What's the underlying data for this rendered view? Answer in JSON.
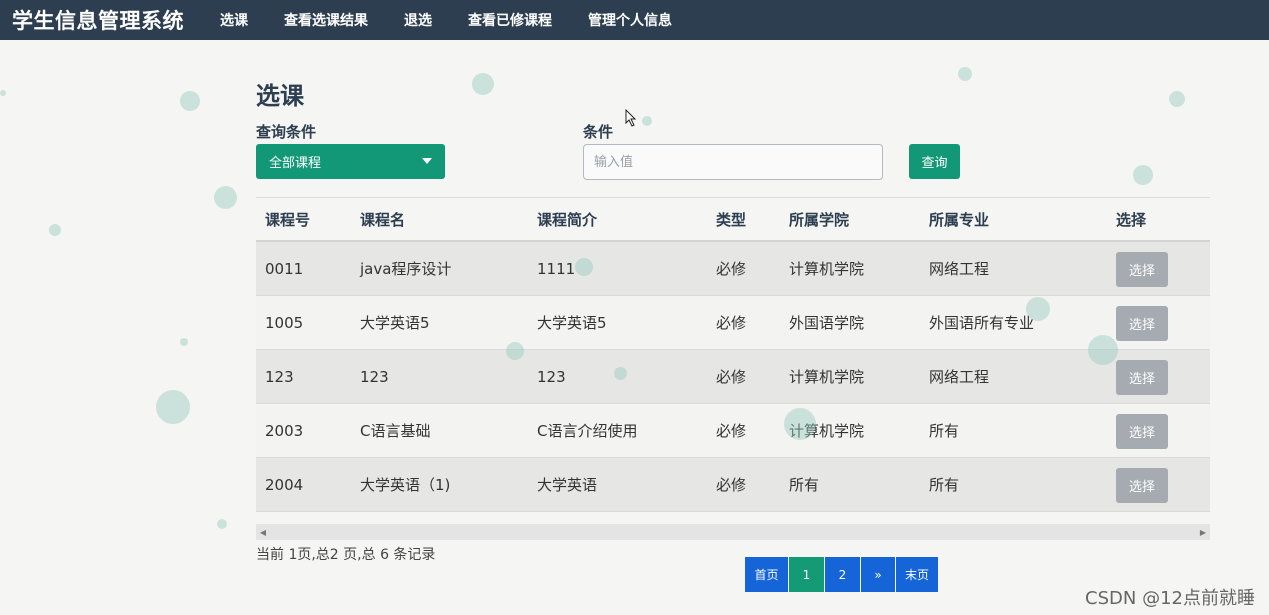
{
  "nav": {
    "brand": "学生信息管理系统",
    "items": [
      "选课",
      "查看选课结果",
      "退选",
      "查看已修课程",
      "管理个人信息"
    ]
  },
  "page": {
    "title": "选课",
    "filter_label": "查询条件",
    "filter_value": "全部课程",
    "condition_label": "条件",
    "condition_placeholder": "输入值",
    "query_button": "查询"
  },
  "table": {
    "headers": [
      "课程号",
      "课程名",
      "课程简介",
      "类型",
      "所属学院",
      "所属专业",
      "选择"
    ],
    "rows": [
      [
        "0011",
        "java程序设计",
        "1111",
        "必修",
        "计算机学院",
        "网络工程",
        "选择"
      ],
      [
        "1005",
        "大学英语5",
        "大学英语5",
        "必修",
        "外国语学院",
        "外国语所有专业",
        "选择"
      ],
      [
        "123",
        "123",
        "123",
        "必修",
        "计算机学院",
        "网络工程",
        "选择"
      ],
      [
        "2003",
        "C语言基础",
        "C语言介绍使用",
        "必修",
        "计算机学院",
        "所有",
        "选择"
      ],
      [
        "2004",
        "大学英语（1)",
        "大学英语",
        "必修",
        "所有",
        "所有",
        "选择"
      ]
    ]
  },
  "footer": {
    "status": "当前 1页,总2 页,总 6 条记录",
    "pager": [
      "首页",
      "1",
      "2",
      "»",
      "末页"
    ],
    "active_page": "1",
    "watermark": "CSDN @12点前就睡"
  },
  "colors": {
    "nav_bg": "#2c3e50",
    "accent_green": "#129877",
    "pager_blue": "#1565d8",
    "select_btn_gray": "#a5abb1"
  },
  "icons": [
    "caret-down-icon",
    "scroll-left-icon",
    "scroll-right-icon",
    "mouse-cursor-icon"
  ]
}
